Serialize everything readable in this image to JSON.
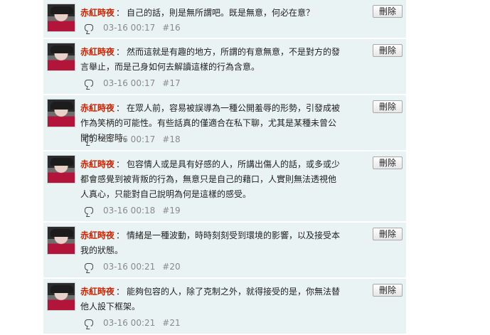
{
  "comments": [
    {
      "author": "赤紅時夜",
      "sep": "：",
      "text": "自己的話，則是無所謂吧。既是無意，何必在意？",
      "date": "03-16 00:17",
      "num": "#16",
      "delete": "刪除"
    },
    {
      "author": "赤紅時夜",
      "sep": "：",
      "text": "然而這就是有趣的地方，所謂的有意無意，不是對方的發言舉止，而是己身如何去解讀這樣的行為含意。",
      "date": "03-16 00:17",
      "num": "#17",
      "delete": "刪除"
    },
    {
      "author": "赤紅時夜",
      "sep": "：",
      "text": "在眾人前，容易被誤導為一種公開羞辱的形勢，引發成被作為笑柄的可能性。有些話真的僅適合在私下聊，尤其是某種未曾公開的秘密時。",
      "date": "03-16 00:17",
      "num": "#18",
      "delete": "刪除"
    },
    {
      "author": "赤紅時夜",
      "sep": "：",
      "text": "包容情人或是具有好感的人，所講出傷人的話，或多或少都會感覺到被背叛的行為，無意只是自己的藉口，人實則無法透視他人真心，只能對自己說明為何是這樣的感受。",
      "date": "03-16 00:18",
      "num": "#19",
      "delete": "刪除"
    },
    {
      "author": "赤紅時夜",
      "sep": "：",
      "text": "情緒是一種波動，時時刻刻受到環境的影響，以及接受本我的狀態。",
      "date": "03-16 00:21",
      "num": "#20",
      "delete": "刪除"
    },
    {
      "author": "赤紅時夜",
      "sep": "：",
      "text": "能夠包容的人，除了克制之外，就得接受的是，你無法替他人設下框架。",
      "date": "03-16 00:21",
      "num": "#21",
      "delete": "刪除"
    }
  ]
}
